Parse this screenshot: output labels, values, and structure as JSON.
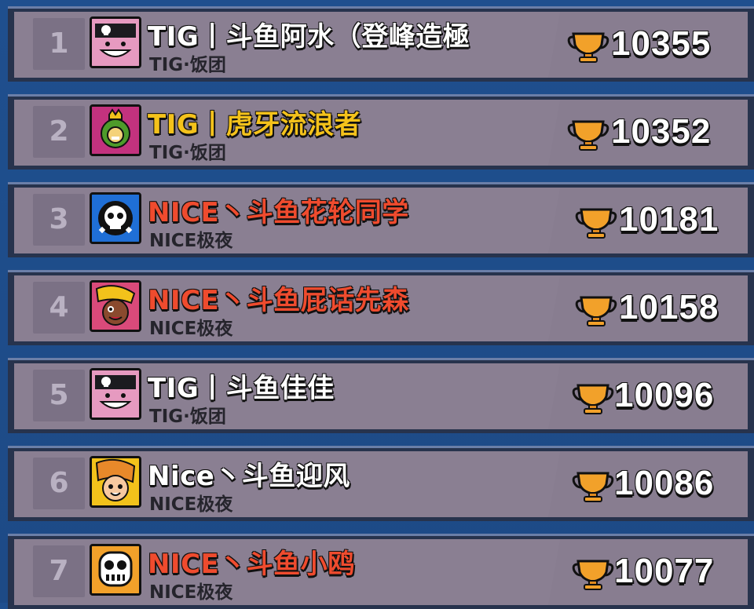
{
  "leaderboard": {
    "colors": {
      "panel": "#8a7f92",
      "rank_box": "#7b7185",
      "background": "#1f4f8e",
      "gold_name": "#f4c21b",
      "red_name": "#ef4b2e",
      "white_name": "#ffffff",
      "trophy": "#f2a12a"
    },
    "rows": [
      {
        "rank": "1",
        "name": "TIG丨斗鱼阿水（登峰造極",
        "club": "TIG·饭团",
        "trophies": "10355",
        "name_color": "white",
        "avatar_icon": "piper-avatar-icon"
      },
      {
        "rank": "2",
        "name": "TIG丨虎牙流浪者",
        "club": "TIG·饭团",
        "trophies": "10352",
        "name_color": "gold",
        "avatar_icon": "sprout-king-avatar-icon"
      },
      {
        "rank": "3",
        "name": "NICE丶斗鱼花轮同学",
        "club": "NICE极夜",
        "trophies": "10181",
        "name_color": "red",
        "avatar_icon": "skull-logo-avatar-icon"
      },
      {
        "rank": "4",
        "name": "NICE丶斗鱼屁话先森",
        "club": "NICE极夜",
        "trophies": "10158",
        "name_color": "red",
        "avatar_icon": "bea-avatar-icon"
      },
      {
        "rank": "5",
        "name": "TIG丨斗鱼佳佳",
        "club": "TIG·饭团",
        "trophies": "10096",
        "name_color": "white",
        "avatar_icon": "piper-avatar-icon"
      },
      {
        "rank": "6",
        "name": "Nice丶斗鱼迎风",
        "club": "NICE极夜",
        "trophies": "10086",
        "name_color": "white",
        "avatar_icon": "jessie-avatar-icon"
      },
      {
        "rank": "7",
        "name": "NICE丶斗鱼小鸥",
        "club": "NICE极夜",
        "trophies": "10077",
        "name_color": "red",
        "avatar_icon": "robot-skull-avatar-icon"
      }
    ]
  }
}
